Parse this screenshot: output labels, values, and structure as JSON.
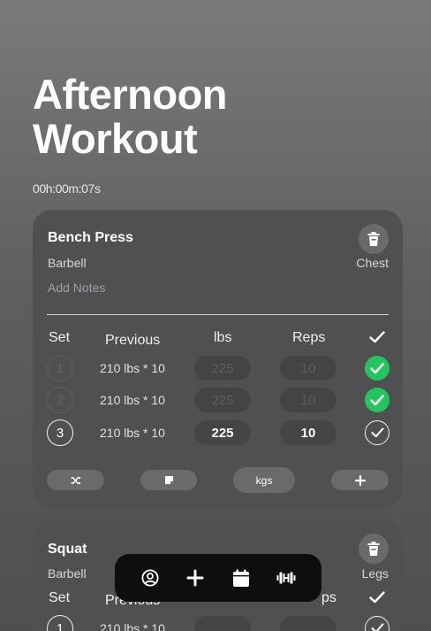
{
  "workout": {
    "title_line1": "Afternoon",
    "title_line2": "Workout",
    "timer": "00h:00m:07s"
  },
  "headers": {
    "set": "Set",
    "previous": "Previous",
    "lbs": "lbs",
    "reps": "Reps"
  },
  "exercises": [
    {
      "name": "Bench Press",
      "equipment": "Barbell",
      "muscle": "Chest",
      "notes_placeholder": "Add Notes",
      "sets": [
        {
          "num": "1",
          "previous": "210 lbs * 10",
          "lbs": "225",
          "reps": "10",
          "completed": true
        },
        {
          "num": "2",
          "previous": "210 lbs * 10",
          "lbs": "225",
          "reps": "10",
          "completed": true
        },
        {
          "num": "3",
          "previous": "210 lbs * 10",
          "lbs": "225",
          "reps": "10",
          "completed": false
        }
      ],
      "actions": {
        "shuffle_icon": "shuffle-icon",
        "note_icon": "sticky-note-icon",
        "units_label": "kgs",
        "add_icon": "plus-icon"
      }
    },
    {
      "name": "Squat",
      "equipment": "Barbell",
      "muscle": "Legs",
      "sets": [
        {
          "num": "1",
          "previous": "210 lbs * 10",
          "completed": false
        }
      ],
      "partial_headers": {
        "previous": "Previous",
        "reps": "ps"
      }
    }
  ],
  "navbar": {
    "items": [
      "profile-icon",
      "add-icon",
      "calendar-icon",
      "dumbbell-icon"
    ]
  },
  "colors": {
    "completed": "#22c55e",
    "navbar": "#0e0e0e",
    "card": "#505050"
  }
}
